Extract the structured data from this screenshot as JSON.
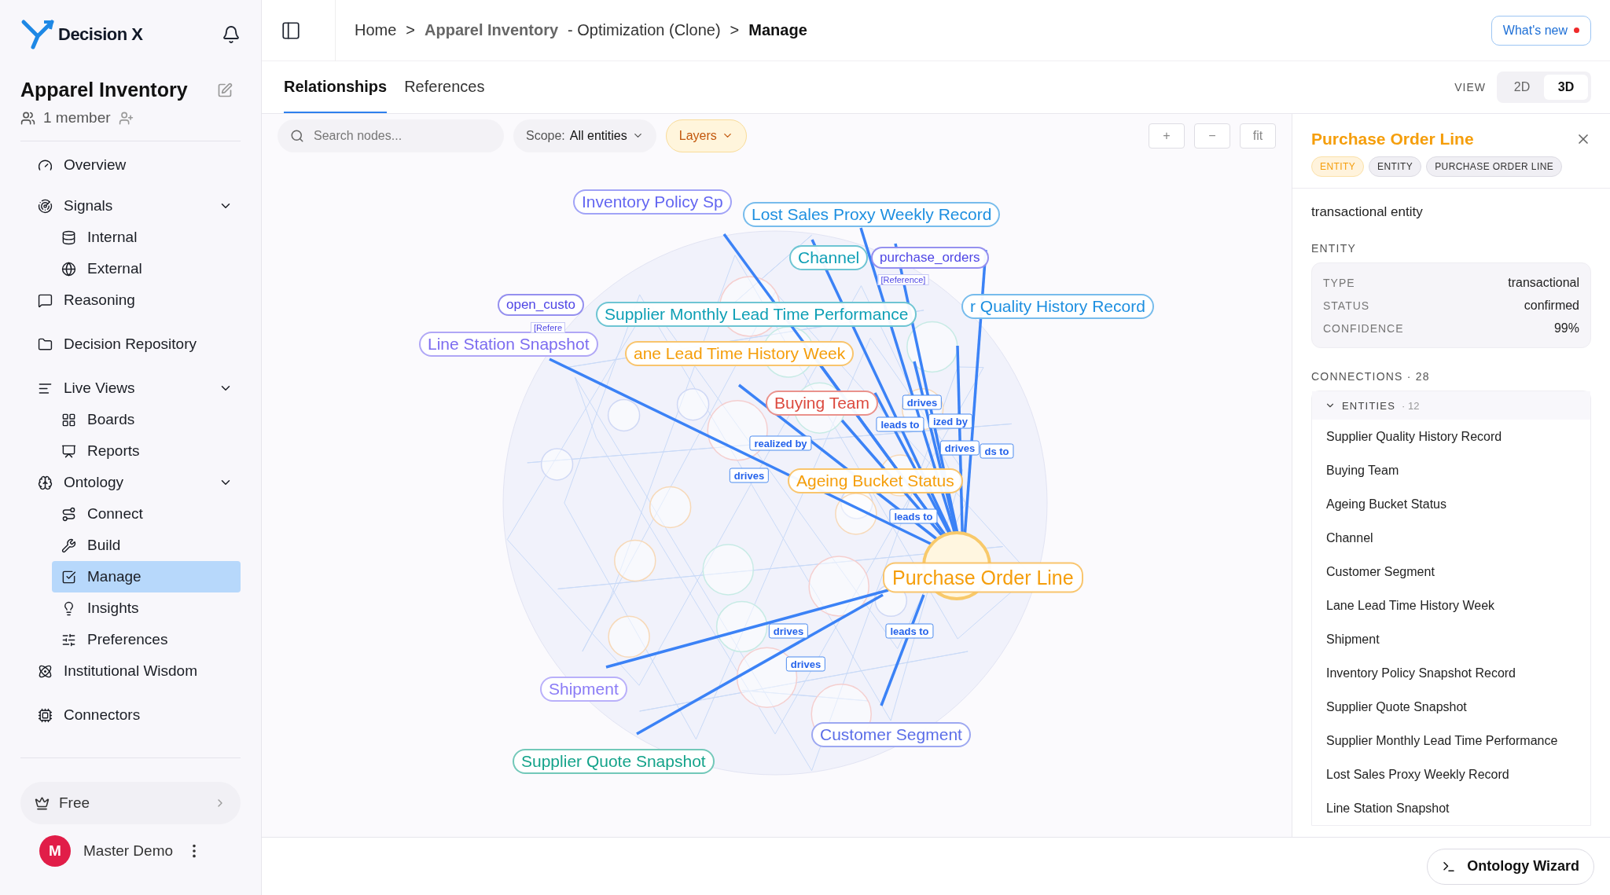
{
  "sidebar": {
    "logo": "Decision X",
    "project": "Apparel Inventory",
    "members": "1 member",
    "nav": [
      {
        "label": "Overview",
        "selected": false
      },
      {
        "label": "Signals",
        "selected": false,
        "expanded": true,
        "children": [
          {
            "label": "Internal",
            "selected": false
          },
          {
            "label": "External",
            "selected": false
          }
        ]
      },
      {
        "label": "Reasoning",
        "selected": false
      },
      {
        "label": "Decision Repository",
        "selected": false
      },
      {
        "label": "Live Views",
        "selected": false,
        "expanded": true,
        "children": [
          {
            "label": "Boards",
            "selected": false
          },
          {
            "label": "Reports",
            "selected": false
          }
        ]
      },
      {
        "label": "Ontology",
        "selected": false,
        "expanded": true,
        "children": [
          {
            "label": "Connect",
            "selected": false
          },
          {
            "label": "Build",
            "selected": false
          },
          {
            "label": "Manage",
            "selected": true
          },
          {
            "label": "Insights",
            "selected": false
          },
          {
            "label": "Preferences",
            "selected": false
          }
        ]
      },
      {
        "label": "Institutional Wisdom",
        "selected": false
      },
      {
        "label": "Connectors",
        "selected": false
      }
    ],
    "plan": "Free",
    "user": {
      "initial": "M",
      "name": "Master Demo"
    }
  },
  "header": {
    "separator": ">",
    "crumbs": [
      {
        "label": "Home"
      },
      {
        "label": "Apparel Inventory",
        "suffix": "- Optimization (Clone)"
      },
      {
        "label": "Manage",
        "current": true
      }
    ],
    "whats_new": {
      "label": "What's new",
      "unread": true
    }
  },
  "tabs": [
    {
      "label": "Relationships",
      "selected": true
    },
    {
      "label": "References",
      "selected": false
    }
  ],
  "view": {
    "label": "VIEW",
    "options": [
      {
        "label": "2D",
        "selected": false
      },
      {
        "label": "3D",
        "selected": true
      }
    ]
  },
  "toolbar": {
    "search": {
      "placeholder": "Search nodes..."
    },
    "scope": {
      "label": "Scope:",
      "value": "All entities"
    },
    "layers": "Layers",
    "zoom": [
      "+",
      "−",
      "fit"
    ]
  },
  "graph": {
    "nodes": [
      {
        "label": "Inventory Policy Sp",
        "kind": "entity",
        "color": "#6366f1"
      },
      {
        "label": "Lost Sales Proxy Weekly Record",
        "kind": "entity",
        "color": "#1d8fe0"
      },
      {
        "label": "Channel",
        "kind": "entity",
        "color": "#0e9fb5"
      },
      {
        "label": "purchase_orders",
        "kind": "reference",
        "color": "#4f46e5"
      },
      {
        "label": "open_custo",
        "kind": "reference",
        "color": "#4f46e5"
      },
      {
        "label": "r Quality History Record",
        "kind": "entity",
        "color": "#1d8fe0"
      },
      {
        "label": "Supplier Monthly Lead Time Performance",
        "kind": "entity",
        "color": "#0e9fb5"
      },
      {
        "label": "Line Station Snapshot",
        "kind": "entity",
        "color": "#7c6cf0"
      },
      {
        "label": "ane Lead Time History Week",
        "kind": "entity",
        "color": "#f59e0b"
      },
      {
        "label": "Buying Team",
        "kind": "entity",
        "color": "#dc4a3f"
      },
      {
        "label": "Ageing Bucket Status",
        "kind": "entity",
        "color": "#f59e0b"
      },
      {
        "label": "Purchase Order Line",
        "kind": "focus",
        "color": "#f59e0b"
      },
      {
        "label": "Shipment",
        "kind": "entity",
        "color": "#8b7cf6"
      },
      {
        "label": "Customer Segment",
        "kind": "entity",
        "color": "#5b6ee8"
      },
      {
        "label": "Supplier Quote Snapshot",
        "kind": "entity",
        "color": "#14a38a"
      }
    ],
    "reference_tags": [
      "[Reference]",
      "[Refere"
    ],
    "edge_labels": [
      "drives",
      "leads to",
      "ized by",
      "drives",
      "ds to",
      "realized by",
      "drives",
      "leads to",
      "drives",
      "drives",
      "leads to"
    ]
  },
  "panel": {
    "title": "Purchase Order Line",
    "tags": [
      {
        "label": "ENTITY",
        "kind": "primary"
      },
      {
        "label": "ENTITY",
        "kind": "plain"
      },
      {
        "label": "PURCHASE ORDER LINE",
        "kind": "plain"
      }
    ],
    "description": "transactional entity",
    "entity_heading": "ENTITY",
    "entity_rows": [
      {
        "label": "TYPE",
        "value": "transactional"
      },
      {
        "label": "STATUS",
        "value": "confirmed"
      },
      {
        "label": "CONFIDENCE",
        "value": "99%"
      }
    ],
    "connections_heading": "CONNECTIONS · 28",
    "group": {
      "label": "ENTITIES",
      "count": "· 12",
      "expanded": true,
      "items": [
        "Supplier Quality History Record",
        "Buying Team",
        "Ageing Bucket Status",
        "Channel",
        "Customer Segment",
        "Lane Lead Time History Week",
        "Shipment",
        "Inventory Policy Snapshot Record",
        "Supplier Quote Snapshot",
        "Supplier Monthly Lead Time Performance",
        "Lost Sales Proxy Weekly Record",
        "Line Station Snapshot"
      ]
    }
  },
  "footer": {
    "wizard": "Ontology Wizard"
  }
}
